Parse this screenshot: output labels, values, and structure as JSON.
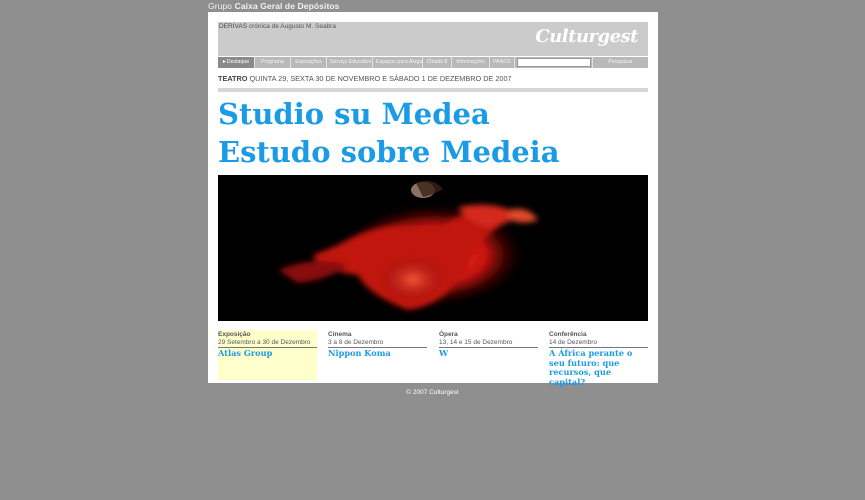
{
  "brand": {
    "prefix": "Grupo",
    "name": "Caixa Geral de Depósitos"
  },
  "header": {
    "section": "DERIVAS",
    "subtitle": "crónica de Augusto M. Seabra",
    "logo": "Culturgest"
  },
  "nav": {
    "items": [
      {
        "label": "Destaque",
        "active": true
      },
      {
        "label": "Programa"
      },
      {
        "label": "Exposições"
      },
      {
        "label": "Serviço Educativo"
      },
      {
        "label": "Espaços para Alugar"
      },
      {
        "label": "Chiado 8"
      },
      {
        "label": "Informações"
      },
      {
        "label": "PANOS"
      }
    ],
    "search_value": "",
    "search_button": "Pesquisar"
  },
  "event": {
    "category": "TEATRO",
    "dates": "QUINTA 29, SEXTA 30 DE NOVEMBRO E SÁBADO 1 DE DEZEMBRO DE 2007"
  },
  "title": {
    "line1": "Studio su Medea",
    "line2": "Estudo sobre Medeia"
  },
  "features": [
    {
      "category": "Exposição",
      "date": "29 Setembro a 30 de Dezembro",
      "link": "Atlas Group",
      "highlight": true
    },
    {
      "category": "Cinema",
      "date": "3 a 8 de Dezembro",
      "link": "Nippon Koma"
    },
    {
      "category": "Ópera",
      "date": "13, 14 e 15 de Dezembro",
      "link": "W"
    },
    {
      "category": "Conferência",
      "date": "14 de Dezembro",
      "link": "A África perante o seu futuro: que recursos, que capital?"
    }
  ],
  "footer": "© 2007 Culturgest",
  "colors": {
    "background": "#8f8f8f",
    "accent": "#1a9be6",
    "highlight": "#ffffcc"
  }
}
